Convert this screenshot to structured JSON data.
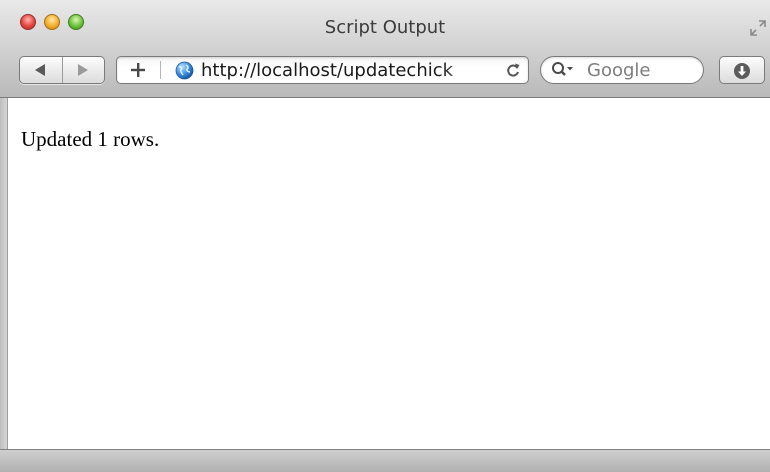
{
  "window": {
    "title": "Script Output"
  },
  "toolbar": {
    "back_icon": "back-arrow-icon",
    "forward_icon": "forward-arrow-icon",
    "add_bookmark_label": "+",
    "address": {
      "url": "http://localhost/updatechick",
      "site_icon": "globe-icon",
      "reload_icon": "reload-icon"
    },
    "search": {
      "placeholder": "Google",
      "icon": "search-icon"
    },
    "downloads_icon": "downloads-icon"
  },
  "page": {
    "output_text": "Updated 1 rows."
  }
}
